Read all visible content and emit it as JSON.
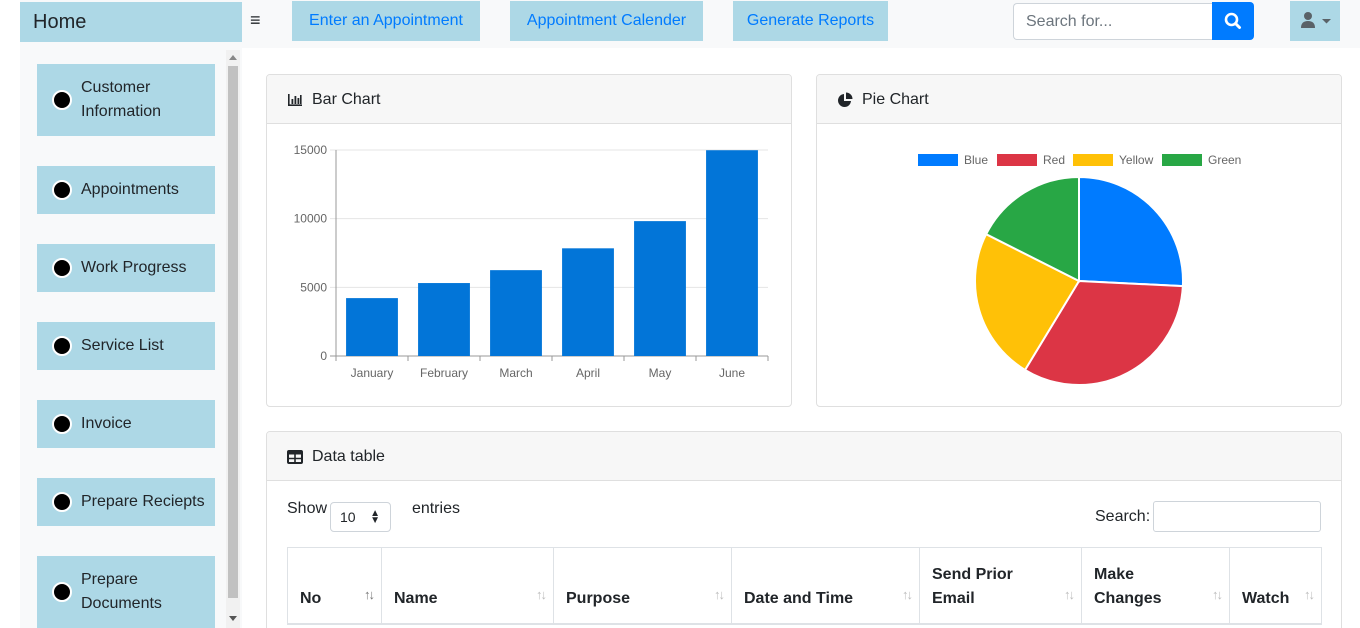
{
  "topbar": {
    "brand": "Home",
    "menu_icon": "hamburger-icon",
    "nav": [
      "Enter an Appointment",
      "Appointment Calender",
      "Generate Reports"
    ],
    "search_placeholder": "Search for...",
    "search_icon": "search-icon",
    "user_icon": "user-icon"
  },
  "sidebar": {
    "items": [
      {
        "label_lines": [
          "Customer",
          "Information"
        ]
      },
      {
        "label_lines": [
          "Appointments"
        ]
      },
      {
        "label_lines": [
          "Work Progress"
        ]
      },
      {
        "label_lines": [
          "Service List"
        ]
      },
      {
        "label_lines": [
          "Invoice"
        ]
      },
      {
        "label_lines": [
          "Prepare Reciepts"
        ]
      },
      {
        "label_lines": [
          "Prepare",
          "Documents"
        ]
      }
    ]
  },
  "bar_card": {
    "title": "Bar Chart",
    "icon": "bar-chart-icon"
  },
  "pie_card": {
    "title": "Pie Chart",
    "icon": "pie-chart-icon"
  },
  "table_card": {
    "title": "Data table",
    "icon": "table-icon",
    "show_label": "Show",
    "entries_label": "entries",
    "length_value": "10",
    "search_label": "Search:",
    "columns": [
      {
        "lines": [
          "No"
        ]
      },
      {
        "lines": [
          "Name"
        ]
      },
      {
        "lines": [
          "Purpose"
        ]
      },
      {
        "lines": [
          "Date and Time"
        ]
      },
      {
        "lines": [
          "Send Prior",
          "Email"
        ]
      },
      {
        "lines": [
          "Make",
          "Changes"
        ]
      },
      {
        "lines": [
          "Watch"
        ]
      }
    ]
  },
  "colors": {
    "nav_bg": "#add8e6",
    "primary": "#007bff",
    "bar": "#0275d8",
    "pie_blue": "#007bff",
    "pie_red": "#dc3545",
    "pie_yellow": "#ffc107",
    "pie_green": "#28a745"
  },
  "chart_data": [
    {
      "type": "bar",
      "categories": [
        "January",
        "February",
        "March",
        "April",
        "May",
        "June"
      ],
      "values": [
        4215,
        5312,
        6251,
        7841,
        9821,
        14984
      ],
      "ylim": [
        0,
        15000
      ],
      "yticks": [
        0,
        5000,
        10000,
        15000
      ],
      "grid": true,
      "legend": false
    },
    {
      "type": "pie",
      "labels": [
        "Blue",
        "Red",
        "Yellow",
        "Green"
      ],
      "values": [
        12.21,
        15.58,
        11.25,
        8.32
      ],
      "colors": [
        "#007bff",
        "#dc3545",
        "#ffc107",
        "#28a745"
      ],
      "legend": "top"
    }
  ]
}
